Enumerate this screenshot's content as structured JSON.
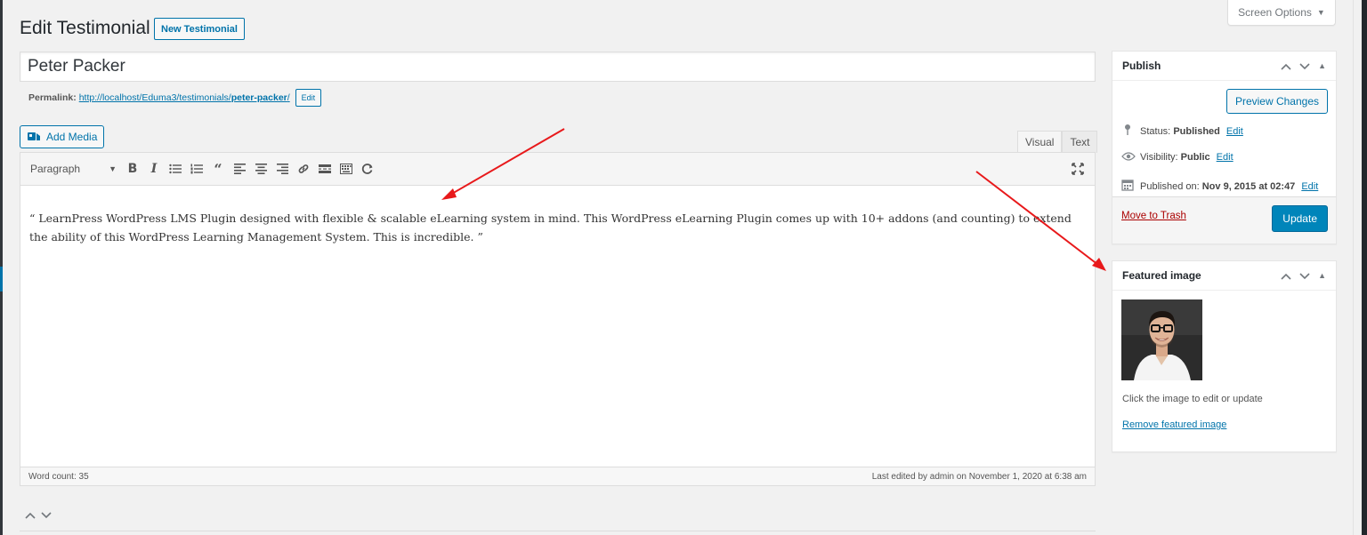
{
  "screen_options": {
    "label": "Screen Options",
    "arrow": "▼"
  },
  "header": {
    "title": "Edit Testimonial",
    "new_button": "New Testimonial"
  },
  "post": {
    "title_value": "Peter Packer"
  },
  "permalink": {
    "label": "Permalink:",
    "url_prefix": "http://localhost/Eduma3/testimonials/",
    "slug": "peter-packer",
    "url_suffix": "/",
    "edit_label": "Edit"
  },
  "media": {
    "add_label": "Add Media"
  },
  "editor": {
    "tabs": [
      "Visual",
      "Text"
    ],
    "format_value": "Paragraph",
    "content": "“ LearnPress WordPress LMS Plugin designed with flexible & scalable eLearning system in mind. This WordPress eLearning Plugin comes up with 10+ addons (and counting) to extend the ability of this WordPress Learning Management System. This is incredible. ”",
    "word_count": "Word count: 35",
    "last_edited": "Last edited by admin on November 1, 2020 at 6:38 am",
    "toolbar_icons": [
      "bold-icon",
      "italic-icon",
      "bullet-list-icon",
      "numbered-list-icon",
      "blockquote-icon",
      "align-left-icon",
      "align-center-icon",
      "align-right-icon",
      "link-icon",
      "read-more-icon",
      "toolbar-toggle-icon",
      "refresh-icon",
      "fullscreen-icon"
    ]
  },
  "publish_box": {
    "title": "Publish",
    "preview_label": "Preview Changes",
    "status_label": "Status:",
    "status_value": "Published",
    "visibility_label": "Visibility:",
    "visibility_value": "Public",
    "published_label": "Published on:",
    "published_value": "Nov 9, 2015 at 02:47",
    "edit_label": "Edit",
    "trash_label": "Move to Trash",
    "update_label": "Update"
  },
  "featured_box": {
    "title": "Featured image",
    "help_text": "Click the image to edit or update",
    "remove_label": "Remove featured image"
  },
  "colors": {
    "accent": "#0073aa",
    "primary_button": "#0085ba",
    "trash": "#a00000",
    "annotation_arrow": "#e8191b"
  }
}
